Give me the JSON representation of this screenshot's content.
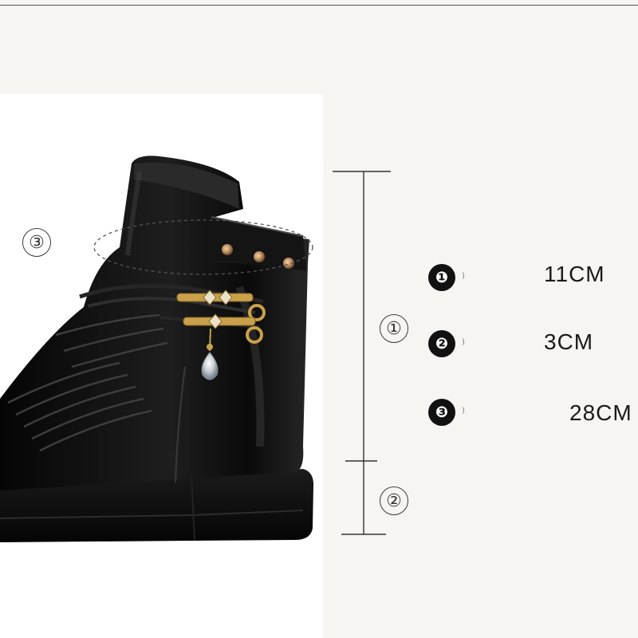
{
  "markers": {
    "height_marker": "①",
    "heel_marker": "②",
    "opening_marker": "③"
  },
  "legend": [
    {
      "badge": "❶",
      "tick": "⁾",
      "value": "11CM"
    },
    {
      "badge": "❷",
      "tick": "⁾",
      "value": "3CM"
    },
    {
      "badge": "❸",
      "tick": "⁾",
      "value": "28CM"
    }
  ],
  "colors": {
    "background": "#f7f5f2",
    "leather": "#0d0d0d",
    "hardware": "#c9a14a"
  }
}
